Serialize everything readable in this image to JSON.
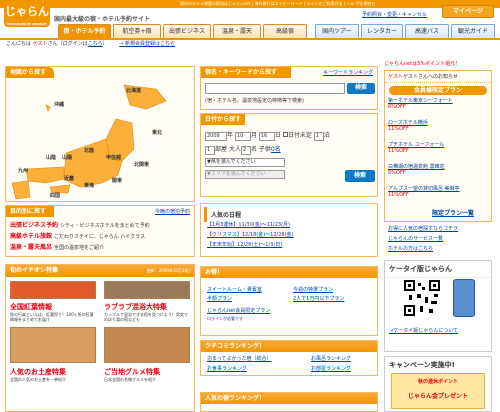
{
  "header": {
    "logo": "じゃらん",
    "logo_sub": "PRODUCED BY RECRUIT",
    "tagline": "国内最大級の宿・ホテル予約サイト",
    "top_links": [
      "国内のホテル旅館の宿泊はじゃらんnet",
      "海外旅行はエイビーロード",
      "ライトのご利用方法",
      "ヘルプ/お問合せ"
    ],
    "sub_links": [
      "予約照会・変更・キャンセル"
    ],
    "mypage": "マイページ",
    "greeting": "こんにちは",
    "guest": "ゲスト",
    "greeting2": "さん（ログインは",
    "here": "こちら",
    "greeting3": "）",
    "new_member": "→ 新規会員登録はこちら"
  },
  "tabs": [
    "宿・ホテル予約",
    "航空券+宿",
    "出張ビジネス",
    "温泉・露天",
    "高級宿",
    "国内ツアー",
    "レンタカー",
    "高速バス",
    "観光ガイド"
  ],
  "map": {
    "title": "地図から探す",
    "regions": [
      "北海道",
      "東北",
      "北関東",
      "甲信越",
      "関東",
      "東海",
      "北陸",
      "近畿",
      "山陰",
      "山陽",
      "四国",
      "九州",
      "沖縄"
    ],
    "overseas": "今晩の宿泊予約"
  },
  "purpose": {
    "title": "目的別に探す",
    "more": "今晩の宿泊予約",
    "items": [
      {
        "label": "出張ビジネス予約",
        "desc": "シティ・ビジネスホテルをまとめて予約"
      },
      {
        "label": "高級ホテル旅館",
        "desc": "こだわりステイに、じゃらん ハイクラス"
      },
      {
        "label": "温泉・露天風呂",
        "desc": "全国の温泉地をご紹介"
      }
    ]
  },
  "keyword": {
    "title": "宿名・キーワードから探す",
    "ranking": "キーワードランキング",
    "placeholder": "",
    "button": "検索",
    "hint": "(宿・ホテル名、温泉地設定の特徴等で検索)"
  },
  "date": {
    "title": "日付から探す",
    "year": "2009",
    "year_unit": "年",
    "month": "10",
    "month_unit": "月",
    "day": "16",
    "day_unit": "日",
    "undecided": "日付未定",
    "nights": "1",
    "nights_unit": "泊",
    "rooms": "1",
    "rooms_unit": "部屋",
    "adults_label": "大人",
    "adults": "2",
    "adults_unit": "名",
    "kids_label": "子供",
    "kids": "0名",
    "pref": "▼県を選んでください",
    "area": "▼エリアを選んでください",
    "button": "検索"
  },
  "schedule": {
    "title": "人気の日程",
    "items": [
      "【1月3連休】11/30(金)～11/23(月)",
      "【クリスマス】12/18(金)～12/26(金)",
      "【年末年始】12/26(土)～1/3(日)"
    ]
  },
  "featured": {
    "title": "旬のイチオシ特集",
    "updated": "更新：2009年10月16日",
    "items": [
      {
        "label": "全国紅葉情報",
        "desc": "秋の行楽といえば、紅葉狩り！100ヶ所の紅葉情報をまとめてお届け"
      },
      {
        "label": "ラブラブ混浴大特集",
        "desc": "カップルで混浴できる宿を見つけよう！男女でのぼり湯の宿なども"
      },
      {
        "label": "人気のお土産特集",
        "desc": "全国の人気のお土産を一挙紹介"
      },
      {
        "label": "ご当地グルメ特集",
        "desc": "日本全国の名物グルメを紹介"
      }
    ]
  },
  "deals": {
    "title": "お得！",
    "items": [
      "スイートルーム・貴賓室",
      "今週の特選プラン",
      "半額プラン",
      "2人で1万円以下プラン",
      "じゃらんnet会員限定プラン",
      "ログインが必要です"
    ]
  },
  "kuchikomi": {
    "title": "クチコミランキング！",
    "items": [
      "泊まってよかった宿（総合）",
      "お風呂ランキング",
      "お食事ランキング",
      "お部屋ランキング"
    ]
  },
  "popular": {
    "title": "人気の宿ランキング！"
  },
  "sidebar": {
    "points": "じゃらんnetは5%ポイント還元！",
    "guest_notice": "ゲストさんへのお知らせ",
    "member_title": "会員様限定プラン",
    "members": [
      {
        "name": "第一ホテル東京シーフォート",
        "pct": "6%OFF"
      },
      {
        "name": "ローズホテル横浜",
        "pct": "11%OFF"
      },
      {
        "name": "プチホテル ユーフォール",
        "pct": "11%OFF"
      },
      {
        "name": "白樺湖の宿温泉館 雲峰荘",
        "pct": "6%OFF"
      },
      {
        "name": "アルプス一望の貸切風呂 美琳亭",
        "pct": "11%OFF"
      }
    ],
    "more_plans": "限定プラン一覧",
    "links": [
      "お得に人気の宿探すならコチラ",
      "じゃらんのサービス一覧",
      "ホテルの方はこちら"
    ],
    "mobile_title": "ケータイ版じゃらん",
    "mobile_link": "→ケータイ版じゃらんについて",
    "campaign_title": "キャンペーン実施中!",
    "campaign_text": "秋の連休ポイント",
    "campaign_text2": "じゃらん金プレゼント"
  }
}
